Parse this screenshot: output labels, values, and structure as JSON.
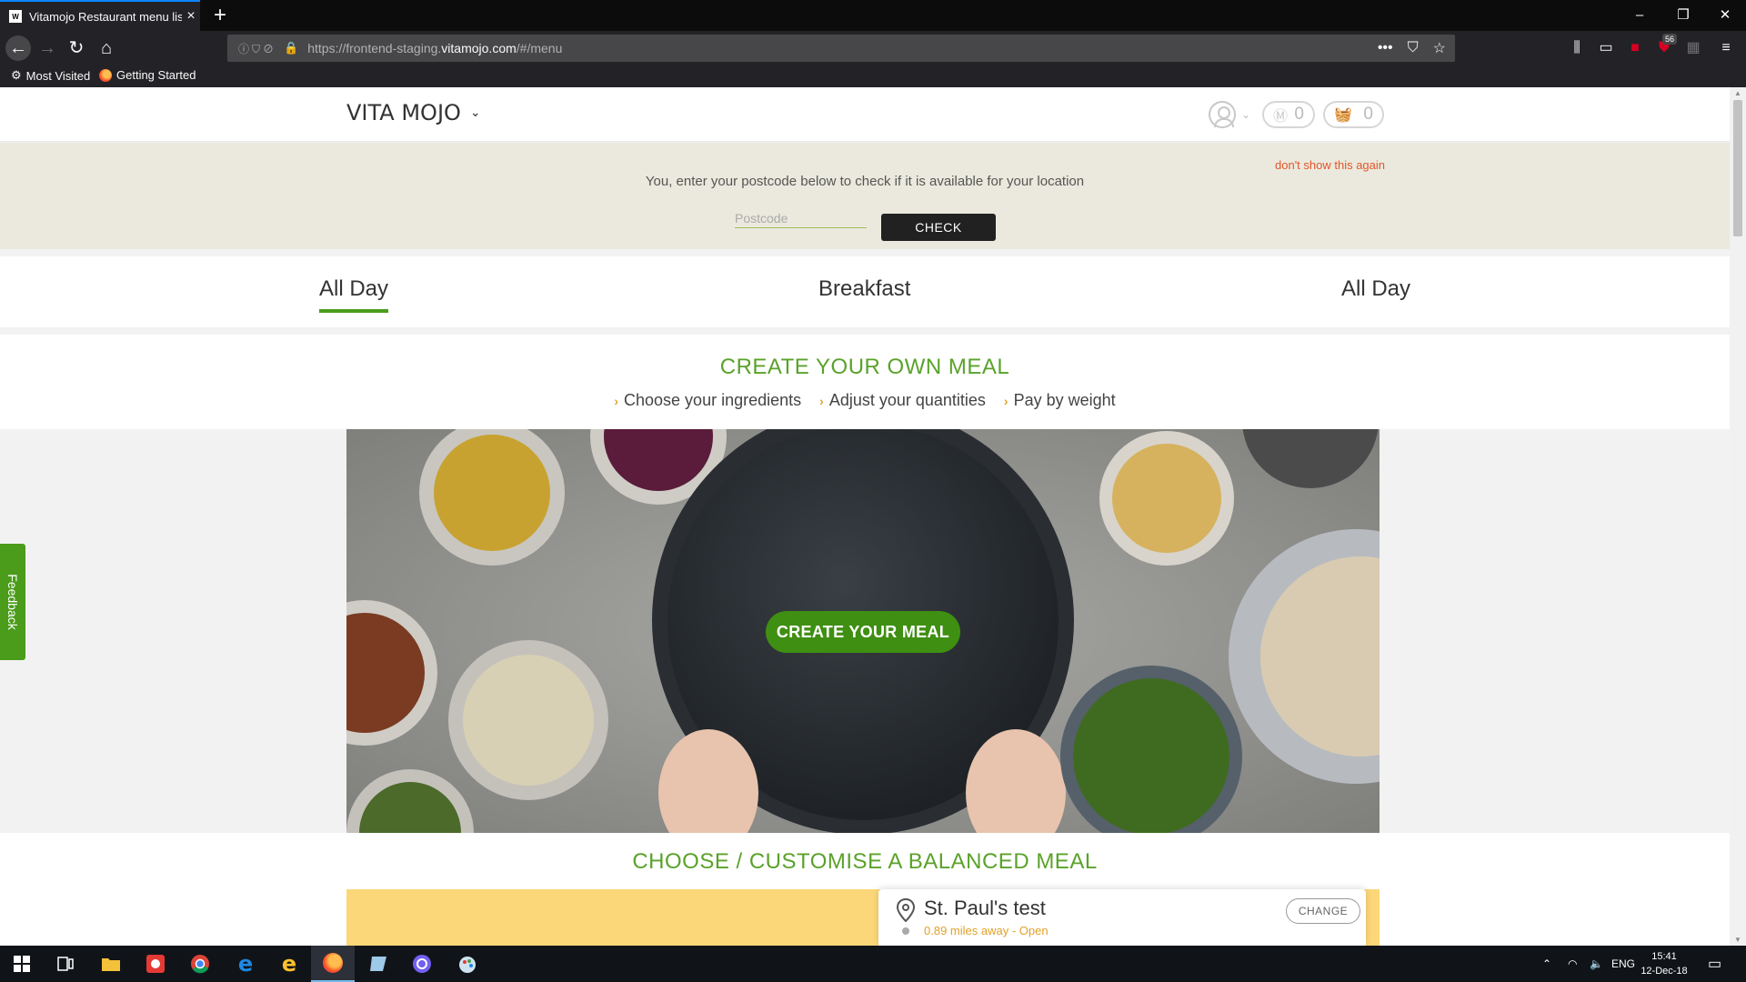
{
  "browser": {
    "tab_title": "Vitamojo Restaurant menu list",
    "tab_favicon": "W",
    "new_tab_label": "+",
    "url_prefix": "https://frontend-staging.",
    "url_host": "vitamojo.com",
    "url_path": "/#/menu",
    "toolbar_badge": "56",
    "bookmarks": [
      "Most Visited",
      "Getting Started"
    ]
  },
  "site": {
    "logo": "VITA MOJO",
    "mojo_points": "0",
    "basket_count": "0"
  },
  "banner": {
    "dismiss": "don't show this again",
    "message": "You, enter your postcode below to check if it is available for your location",
    "postcode_placeholder": "Postcode",
    "check_label": "CHECK"
  },
  "menu_tabs": [
    {
      "label": "All Day",
      "active": true
    },
    {
      "label": "Breakfast",
      "active": false
    },
    {
      "label": "All Day",
      "active": false
    }
  ],
  "create_section": {
    "title": "CREATE YOUR OWN MEAL",
    "steps": [
      "Choose your ingredients",
      "Adjust your quantities",
      "Pay by weight"
    ],
    "cta": "CREATE YOUR MEAL"
  },
  "balanced": {
    "title": "CHOOSE / CUSTOMISE A BALANCED MEAL"
  },
  "feedback": "Feedback",
  "location": {
    "name": "St. Paul's test",
    "distance": "0.89 miles away - Open",
    "change_label": "CHANGE"
  },
  "taskbar": {
    "lang": "ENG",
    "time": "15:41",
    "date": "12-Dec-18"
  },
  "colors": {
    "brand_green": "#4a9c1a",
    "accent_orange": "#e2562c",
    "banner_bg": "#ebe9dd",
    "yellow_strip": "#fcd779"
  }
}
